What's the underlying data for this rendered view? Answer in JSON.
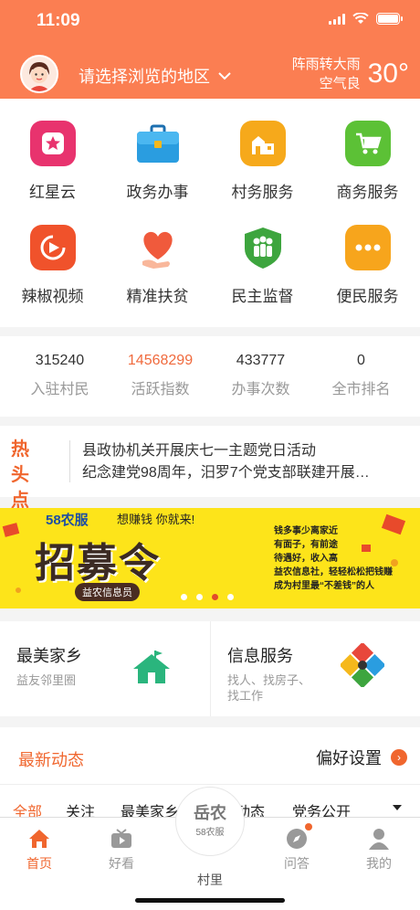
{
  "status": {
    "time": "11:09"
  },
  "header": {
    "region_label": "请选择浏览的地区",
    "weather": {
      "condition": "阵雨转大雨",
      "air": "空气良",
      "temp": "30°"
    }
  },
  "grid": [
    {
      "label": "红星云",
      "icon": "star-icon",
      "color": "#e8336e"
    },
    {
      "label": "政务办事",
      "icon": "briefcase-icon",
      "color": "#2a9de0"
    },
    {
      "label": "村务服务",
      "icon": "village-icon",
      "color": "#f6a91b"
    },
    {
      "label": "商务服务",
      "icon": "cart-icon",
      "color": "#5cc136"
    },
    {
      "label": "辣椒视频",
      "icon": "play-icon",
      "color": "#f0522b"
    },
    {
      "label": "精准扶贫",
      "icon": "heart-hand-icon",
      "color": "#f05a3c"
    },
    {
      "label": "民主监督",
      "icon": "people-shield-icon",
      "color": "#3da53e"
    },
    {
      "label": "便民服务",
      "icon": "more-icon",
      "color": "#f7a51c"
    }
  ],
  "stats": [
    {
      "value": "315240",
      "caption": "入驻村民"
    },
    {
      "value": "14568299",
      "caption": "活跃指数"
    },
    {
      "value": "433777",
      "caption": "办事次数"
    },
    {
      "value": "0",
      "caption": "全市排名"
    }
  ],
  "news": {
    "tag": "热头点条",
    "tag_top": "热 头",
    "tag_bottom": "点 条",
    "items": [
      "县政协机关开展庆七一主题党日活动",
      "纪念建党98周年，汨罗7个党支部联建开展…"
    ]
  },
  "banner": {
    "logo": "58农服",
    "slogan": "想赚钱  你就来!",
    "headline": "招募令",
    "sub_badge": "益农信息员",
    "lines": [
      "钱多事少离家近",
      "有面子，有前途",
      "待遇好，收入高",
      "益农信息社，轻轻松松把钱赚",
      "成为村里最“不差钱”的人"
    ]
  },
  "cards": [
    {
      "title": "最美家乡",
      "subtitle": "益友邻里圈"
    },
    {
      "title": "信息服务",
      "subtitle_lines": [
        "找人、找房子、",
        "找工作"
      ]
    }
  ],
  "latest": {
    "title": "最新动态",
    "preference": "偏好设置"
  },
  "tabs": [
    "全部",
    "关注",
    "最美家乡",
    "动态",
    "党务公开"
  ],
  "nav": {
    "items": [
      {
        "label": "首页",
        "icon": "home-icon"
      },
      {
        "label": "好看",
        "icon": "tv-icon"
      },
      {
        "label": "问答",
        "icon": "compass-icon"
      },
      {
        "label": "我的",
        "icon": "user-icon"
      }
    ],
    "center": {
      "title": "岳农",
      "logo": "58农服",
      "label": "村里"
    }
  },
  "colors": {
    "accent": "#fb7e52",
    "highlight": "#f06a3d"
  }
}
